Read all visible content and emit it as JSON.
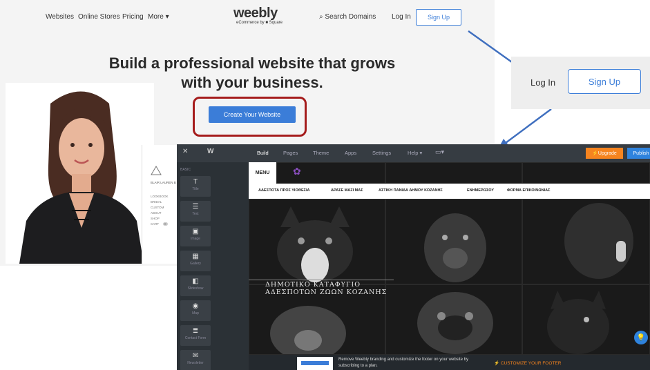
{
  "homepage": {
    "nav": {
      "websites": "Websites",
      "online_stores": "Online Stores",
      "pricing": "Pricing",
      "more": "More",
      "logo": "weebly",
      "logo_sub": "eCommerce by ■ Square",
      "search_domains": "Search Domains",
      "login": "Log In",
      "signup": "Sign Up"
    },
    "hero_line1": "Build a professional website that grows",
    "hero_line2": "with your business.",
    "cta": "Create Your Website",
    "mini_site": {
      "brand": "BLAIR LAUREN B",
      "items": [
        "LOOKBOOK",
        "BRIDAL",
        "CUSTOM",
        "ABOUT",
        "SHOP",
        "CART"
      ],
      "cart_count": "0"
    }
  },
  "callout": {
    "login": "Log In",
    "signup": "Sign Up"
  },
  "editor": {
    "menu": [
      "Build",
      "Pages",
      "Theme",
      "Apps",
      "Settings",
      "Help"
    ],
    "upgrade": "Upgrade",
    "publish": "Publish",
    "sidebar_section": "BASIC",
    "tools": [
      "Title",
      "Text",
      "Image",
      "Gallery",
      "Slideshow",
      "Map",
      "Contact Form",
      "Newsletter"
    ],
    "site": {
      "menu_tab": "MENU",
      "nav": [
        "ΑΔΕΣΠΟΤΑ ΠΡΟΣ ΥΙΟΘΕΣΙΑ",
        "ΔΡΑΣΕ ΜΑΖΙ ΜΑΣ",
        "ΑΣΤΙΚΗ ΠΑΝΙΔΑ ΔΗΜΟΥ ΚΟΖΑΝΗΣ",
        "ΕΝΗΜΕΡΩΣΟΥ",
        "ΦΟΡΜΑ ΕΠΙΚΟΙΝΩΝΙΑΣ"
      ],
      "hero_line1": "ΔΗΜΟΤΙΚΟ ΚΑΤΑΦΥΓΙΟ",
      "hero_line2": "ΑΔΕΣΠΟΤΩΝ ΖΩΩΝ ΚΟΖΑΝΗΣ"
    },
    "footer_text": "Remove Weebly branding and customize the footer on your website by subscribing to a plan.",
    "footer_cta": "CUSTOMIZE YOUR FOOTER"
  },
  "colors": {
    "accent": "#3b7dd8",
    "highlight": "#a51c1c",
    "upgrade": "#f6841f"
  }
}
